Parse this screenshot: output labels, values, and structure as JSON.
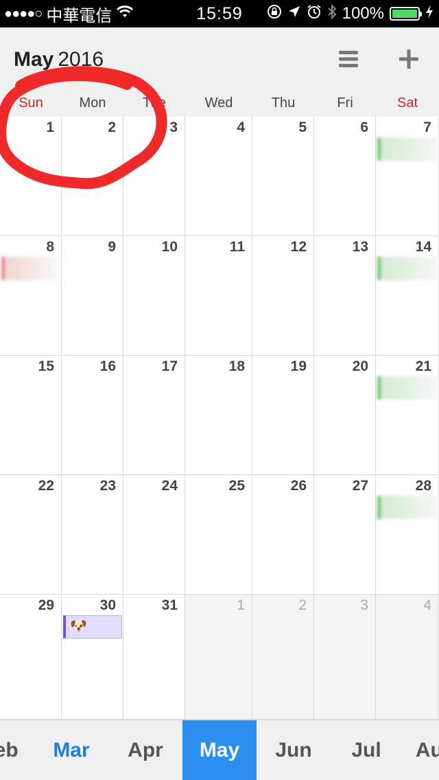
{
  "status_bar": {
    "signal": "●●●●○",
    "carrier": "中華電信",
    "time": "15:59",
    "battery": "100%"
  },
  "header": {
    "month": "May",
    "year": "2016",
    "menu_icon": "hamburger-icon",
    "add_icon": "plus-icon"
  },
  "weekdays": [
    "Sun",
    "Mon",
    "Tue",
    "Wed",
    "Thu",
    "Fri",
    "Sat"
  ],
  "weeks": [
    [
      {
        "day": "1"
      },
      {
        "day": "2"
      },
      {
        "day": "3"
      },
      {
        "day": "4"
      },
      {
        "day": "5"
      },
      {
        "day": "6"
      },
      {
        "day": "7"
      }
    ],
    [
      {
        "day": "8"
      },
      {
        "day": "9"
      },
      {
        "day": "10"
      },
      {
        "day": "11"
      },
      {
        "day": "12"
      },
      {
        "day": "13"
      },
      {
        "day": "14"
      }
    ],
    [
      {
        "day": "15"
      },
      {
        "day": "16"
      },
      {
        "day": "17"
      },
      {
        "day": "18"
      },
      {
        "day": "19"
      },
      {
        "day": "20"
      },
      {
        "day": "21"
      }
    ],
    [
      {
        "day": "22"
      },
      {
        "day": "23"
      },
      {
        "day": "24"
      },
      {
        "day": "25"
      },
      {
        "day": "26"
      },
      {
        "day": "27"
      },
      {
        "day": "28"
      }
    ],
    [
      {
        "day": "29"
      },
      {
        "day": "30"
      },
      {
        "day": "31"
      },
      {
        "day": "1",
        "other": true
      },
      {
        "day": "2",
        "other": true
      },
      {
        "day": "3",
        "other": true
      },
      {
        "day": "4",
        "other": true
      }
    ]
  ],
  "events": [
    {
      "week": 0,
      "col": 6,
      "color": "green",
      "text": ""
    },
    {
      "week": 1,
      "col": 0,
      "color": "red",
      "text": ""
    },
    {
      "week": 1,
      "col": 6,
      "color": "green",
      "text": ""
    },
    {
      "week": 2,
      "col": 6,
      "color": "green",
      "text": ""
    },
    {
      "week": 3,
      "col": 6,
      "color": "green",
      "text": ""
    },
    {
      "week": 4,
      "col": 1,
      "color": "purple",
      "text": "🐶"
    }
  ],
  "months": [
    "Feb",
    "Mar",
    "Apr",
    "May",
    "Jun",
    "Jul",
    "Aug"
  ],
  "active_month_index": 3,
  "accent_month_index": 1,
  "colors": {
    "weekend_label": "#c8282d",
    "active_month_bg": "#2b8ff0",
    "accent_month_text": "#1e7fd6",
    "annotation": "#ee2a2a"
  }
}
